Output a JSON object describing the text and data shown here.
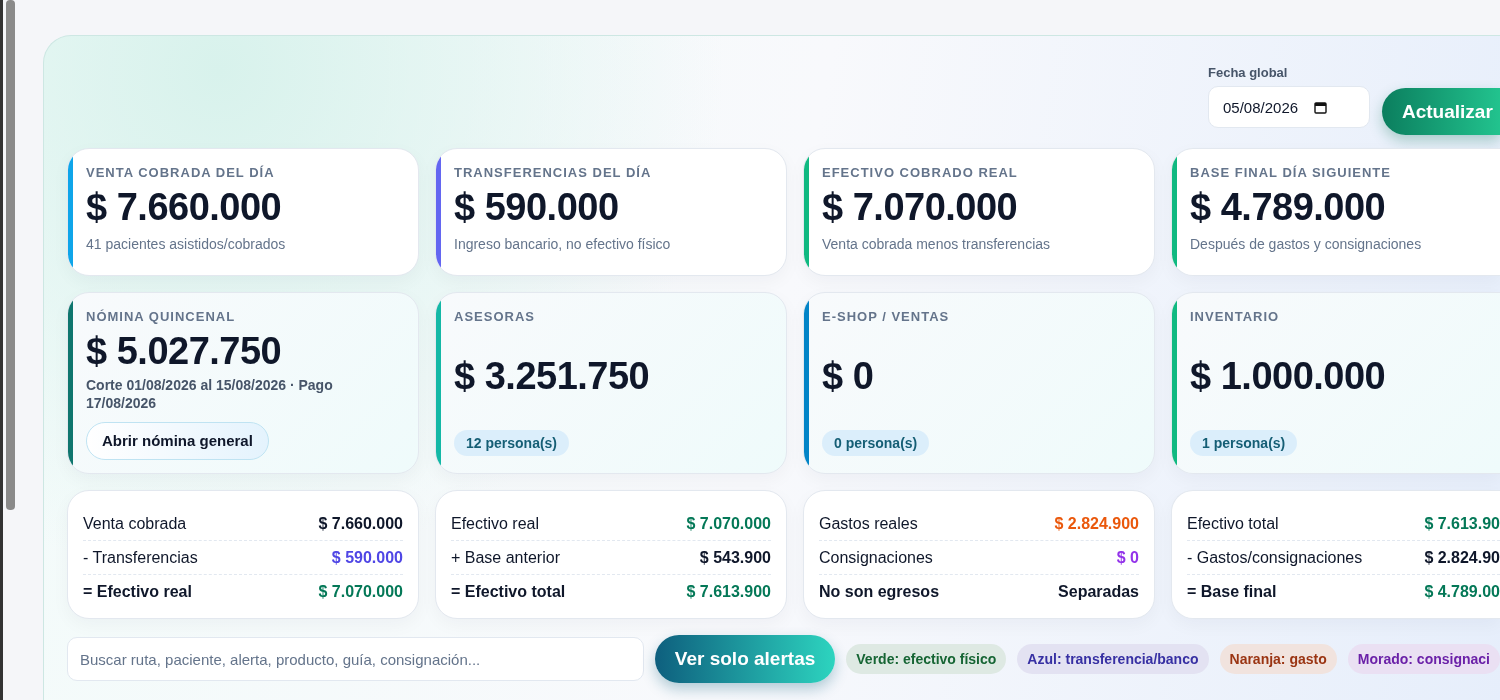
{
  "header": {
    "date_label": "Fecha global",
    "date_value": "05/08/2026",
    "button": "Actualizar"
  },
  "kpis": [
    {
      "label": "VENTA COBRADA DEL DÍA",
      "value": "$ 7.660.000",
      "note": "41 pacientes asistidos/cobrados",
      "color": "#0ea5e9"
    },
    {
      "label": "TRANSFERENCIAS DEL DÍA",
      "value": "$ 590.000",
      "note": "Ingreso bancario, no efectivo físico",
      "color": "#6366f1"
    },
    {
      "label": "EFECTIVO COBRADO REAL",
      "value": "$ 7.070.000",
      "note": "Venta cobrada menos transferencias",
      "color": "#10b981"
    },
    {
      "label": "BASE FINAL DÍA SIGUIENTE",
      "value": "$ 4.789.000",
      "note": "Después de gastos y consignaciones",
      "color": "#10b981"
    }
  ],
  "teams": [
    {
      "kind": "payroll",
      "label": "NÓMINA QUINCENAL",
      "value": "$ 5.027.750",
      "note": "Corte 01/08/2026 al 15/08/2026 · Pago 17/08/2026",
      "button": "Abrir nómina general",
      "color": "#0f766e"
    },
    {
      "kind": "team",
      "label": "ASESORAS",
      "value": "$ 3.251.750",
      "badge": "12 persona(s)",
      "color": "#14b8a6"
    },
    {
      "kind": "team",
      "label": "E-SHOP / VENTAS",
      "value": "$ 0",
      "badge": "0 persona(s)",
      "color": "#0284c7"
    },
    {
      "kind": "team",
      "label": "INVENTARIO",
      "value": "$ 1.000.000",
      "badge": "1 persona(s)",
      "color": "#10b981"
    }
  ],
  "summaries": [
    {
      "rows": [
        {
          "label": "Venta cobrada",
          "value": "$ 7.660.000",
          "total": false,
          "color": "#0f172a"
        },
        {
          "label": "- Transferencias",
          "value": "$ 590.000",
          "total": false,
          "color": "#4f46e5"
        },
        {
          "label": "= Efectivo real",
          "value": "$ 7.070.000",
          "total": true,
          "color": "#047857"
        }
      ]
    },
    {
      "rows": [
        {
          "label": "Efectivo real",
          "value": "$ 7.070.000",
          "total": false,
          "color": "#047857"
        },
        {
          "label": "+ Base anterior",
          "value": "$ 543.900",
          "total": false,
          "color": "#0f172a"
        },
        {
          "label": "= Efectivo total",
          "value": "$ 7.613.900",
          "total": true,
          "color": "#047857"
        }
      ]
    },
    {
      "rows": [
        {
          "label": "Gastos reales",
          "value": "$ 2.824.900",
          "total": false,
          "color": "#ea580c"
        },
        {
          "label": "Consignaciones",
          "value": "$ 0",
          "total": false,
          "color": "#9333ea"
        },
        {
          "label": "No son egresos",
          "value": "Separadas",
          "total": true,
          "color": "#0f172a"
        }
      ]
    },
    {
      "rows": [
        {
          "label": "Efectivo total",
          "value": "$ 7.613.90",
          "total": false,
          "color": "#047857"
        },
        {
          "label": "- Gastos/consignaciones",
          "value": "$ 2.824.90",
          "total": false,
          "color": "#0f172a"
        },
        {
          "label": "= Base final",
          "value": "$ 4.789.00",
          "total": true,
          "color": "#047857"
        }
      ]
    }
  ],
  "search": {
    "placeholder": "Buscar ruta, paciente, alerta, producto, guía, consignación..."
  },
  "alerts_button": "Ver solo alertas",
  "legend": [
    {
      "label": "Verde: efectivo físico",
      "color": "#166534"
    },
    {
      "label": "Azul: transferencia/banco",
      "color": "#3730a3"
    },
    {
      "label": "Naranja: gasto",
      "color": "#9a3412"
    },
    {
      "label": "Morado: consignaci",
      "color": "#6b21a8"
    }
  ]
}
